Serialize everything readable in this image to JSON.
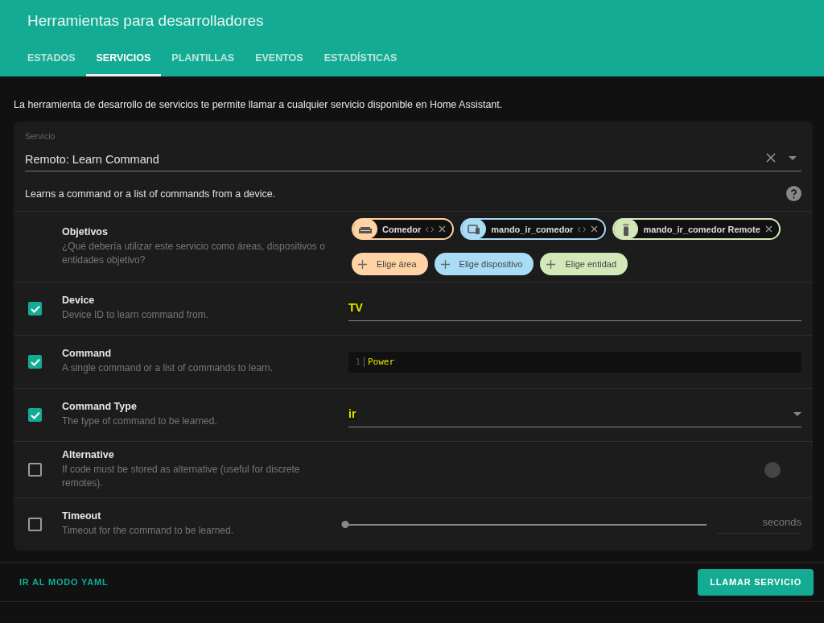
{
  "header": {
    "title": "Herramientas para desarrolladores"
  },
  "tabs": [
    {
      "label": "ESTADOS",
      "selected": false
    },
    {
      "label": "SERVICIOS",
      "selected": true
    },
    {
      "label": "PLANTILLAS",
      "selected": false
    },
    {
      "label": "EVENTOS",
      "selected": false
    },
    {
      "label": "ESTADÍSTICAS",
      "selected": false
    }
  ],
  "intro": "La herramienta de desarrollo de servicios te permite llamar a cualquier servicio disponible en Home Assistant.",
  "service": {
    "label": "Servicio",
    "value": "Remoto: Learn Command",
    "description": "Learns a command or a list of commands from a device."
  },
  "targets": {
    "label": "Objetivos",
    "description": "¿Qué debería utilizar este servicio como áreas, dispositivos o entidades objetivo?",
    "chips": [
      {
        "kind": "area",
        "label": "Comedor",
        "color": "#ffd3a3",
        "expandable": true
      },
      {
        "kind": "device",
        "label": "mando_ir_comedor",
        "color": "#a9dcf5",
        "expandable": true
      },
      {
        "kind": "entity",
        "label": "mando_ir_comedor Remote",
        "color": "#d3e8b8",
        "expandable": false
      }
    ],
    "add_buttons": [
      {
        "label": "Elige área",
        "color": "#ffd3a3"
      },
      {
        "label": "Elige dispositivo",
        "color": "#a9dcf5"
      },
      {
        "label": "Elige entidad",
        "color": "#d3e8b8"
      }
    ]
  },
  "fields": [
    {
      "kind": "text",
      "name": "Device",
      "description": "Device ID to learn command from.",
      "checked": true,
      "value": "TV"
    },
    {
      "kind": "code",
      "name": "Command",
      "description": "A single command or a list of commands to learn.",
      "checked": true,
      "line_number": "1",
      "value": "Power"
    },
    {
      "kind": "select",
      "name": "Command Type",
      "description": "The type of command to be learned.",
      "checked": true,
      "value": "ir"
    },
    {
      "kind": "toggle",
      "name": "Alternative",
      "description": "If code must be stored as alternative (useful for discrete remotes).",
      "checked": false,
      "on": false
    },
    {
      "kind": "slider",
      "name": "Timeout",
      "description": "Timeout for the command to be learned.",
      "checked": false,
      "level": 0,
      "unit": "seconds"
    }
  ],
  "footer": {
    "yaml_link": "IR AL MODO YAML",
    "call_button": "LLAMAR SERVICIO"
  }
}
